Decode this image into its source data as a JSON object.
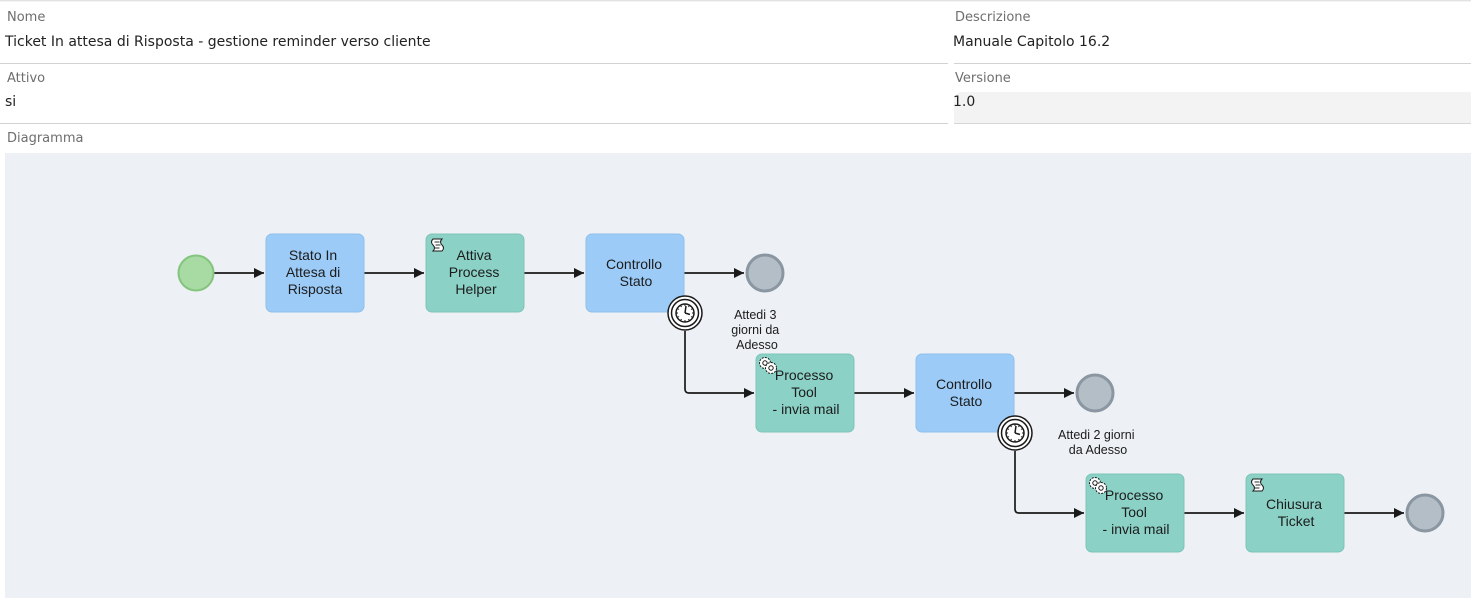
{
  "form": {
    "nome_label": "Nome",
    "nome_value": "Ticket In attesa di Risposta - gestione reminder verso cliente",
    "descrizione_label": "Descrizione",
    "descrizione_value": "Manuale Capitolo 16.2",
    "attivo_label": "Attivo",
    "attivo_value": "si",
    "versione_label": "Versione",
    "versione_value": "1.0",
    "diagramma_label": "Diagramma"
  },
  "diagram": {
    "tasks": {
      "t1": [
        "Stato In",
        "Attesa di",
        "Risposta"
      ],
      "t2": [
        "Attiva",
        "Process",
        "Helper"
      ],
      "t3": [
        "Controllo",
        "Stato"
      ],
      "t4": [
        "Processo",
        "Tool",
        " - invia mail"
      ],
      "t5": [
        "Controllo",
        "Stato"
      ],
      "t6": [
        "Processo",
        "Tool",
        " - invia mail"
      ],
      "t7": [
        "Chiusura",
        "Ticket"
      ]
    },
    "timer1_label": [
      "Attedi 3",
      "giorni da",
      "Adesso"
    ],
    "timer2_label": [
      "Attedi 2 giorni",
      "da Adesso"
    ],
    "colors": {
      "blue_task": "#9ccbf8",
      "green_task": "#8bd1c6",
      "start_event": "#a8dba3",
      "end_event": "#b4bec7",
      "canvas": "#edf0f4"
    }
  }
}
